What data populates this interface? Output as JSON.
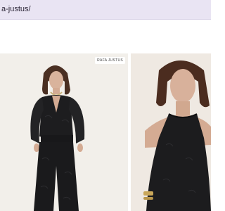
{
  "browser": {
    "address_fragment": "a-justus/"
  },
  "products": [
    {
      "brand_badge": "RAFA JUSTUS",
      "image": "model-black-jacquard-blouse-and-pants"
    },
    {
      "image": "model-black-halter-top"
    }
  ],
  "colors": {
    "address_bar": "#e9e4f3",
    "card_background": "#f2efea",
    "garment": "#1c1c1e"
  }
}
